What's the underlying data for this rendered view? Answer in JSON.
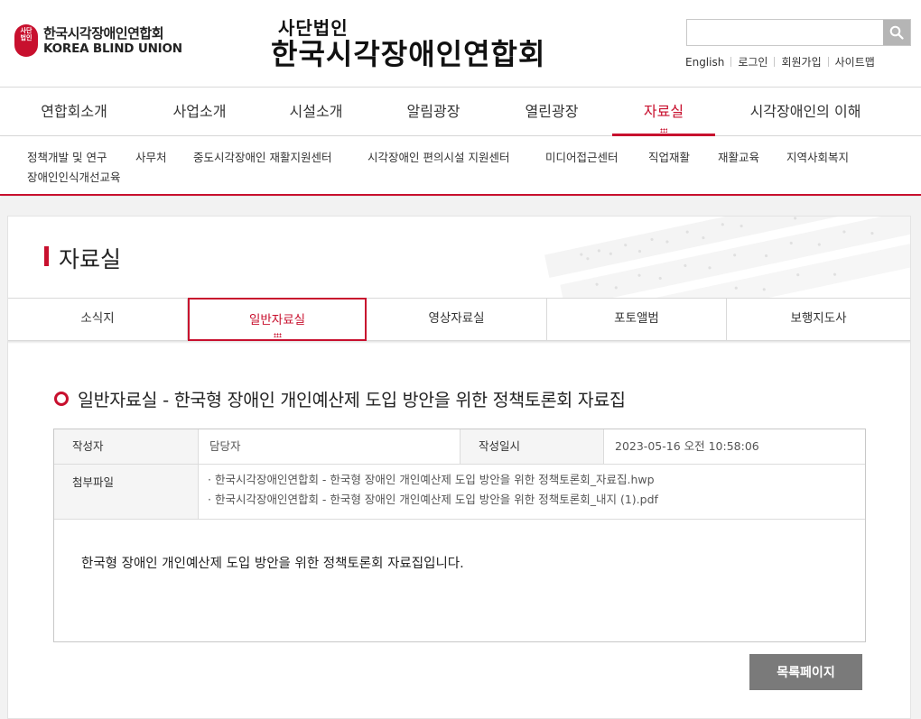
{
  "header": {
    "logo_emblem_text": "사단\n법인",
    "logo_ko": "한국시각장애인연합회",
    "logo_en": "KOREA BLIND UNION",
    "title_sub": "사단법인",
    "title_main": "한국시각장애인연합회",
    "search_placeholder": "",
    "util_links": [
      "English",
      "로그인",
      "회원가입",
      "사이트맵"
    ]
  },
  "gnb": {
    "items": [
      "연합회소개",
      "사업소개",
      "시설소개",
      "알림광장",
      "열린광장",
      "자료실",
      "시각장애인의 이해"
    ],
    "active": "자료실"
  },
  "submenu": {
    "items": [
      "정책개발 및 연구",
      "사무처",
      "중도시각장애인 재활지원센터",
      "시각장애인 편의시설 지원센터",
      "미디어접근센터",
      "직업재활",
      "재활교육",
      "지역사회복지",
      "장애인인식개선교육"
    ]
  },
  "page": {
    "title": "자료실"
  },
  "tabs": {
    "items": [
      "소식지",
      "일반자료실",
      "영상자료실",
      "포토앨범",
      "보행지도사"
    ],
    "active": "일반자료실"
  },
  "article": {
    "title": "일반자료실 - 한국형 장애인 개인예산제 도입 방안을 위한 정책토론회 자료집",
    "author_label": "작성자",
    "author": "담당자",
    "date_label": "작성일시",
    "date": "2023-05-16 오전 10:58:06",
    "files_label": "첨부파일",
    "files": [
      "· 한국시각장애인연합회 - 한국형 장애인 개인예산제 도입 방안을 위한 정책토론회_자료집.hwp",
      "· 한국시각장애인연합회 - 한국형 장애인 개인예산제 도입 방안을 위한 정책토론회_내지 (1).pdf"
    ],
    "body": "한국형 장애인 개인예산제 도입 방안을 위한 정책토론회 자료집입니다."
  },
  "buttons": {
    "list_label": "목록페이지"
  },
  "colors": {
    "accent": "#c8102e",
    "button_bg": "#7a7a7a"
  }
}
